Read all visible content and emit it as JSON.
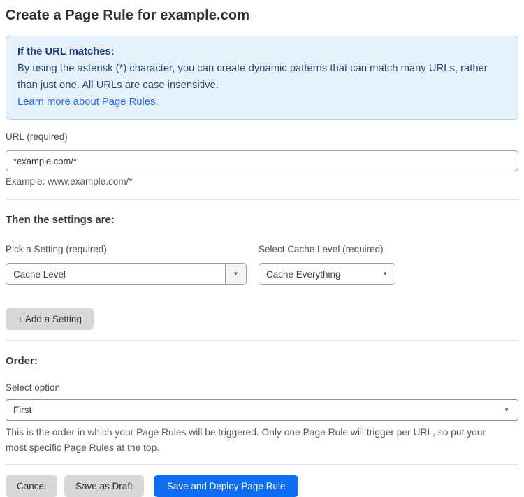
{
  "page": {
    "title": "Create a Page Rule for example.com"
  },
  "info_box": {
    "heading": "If the URL matches:",
    "body": "By using the asterisk (*) character, you can create dynamic patterns that can match many URLs, rather than just one. All URLs are case insensitive.",
    "link_label": "Learn more about Page Rules",
    "link_suffix": "."
  },
  "url_field": {
    "label": "URL (required)",
    "value": "*example.com/*",
    "helper": "Example: www.example.com/*"
  },
  "settings_section": {
    "heading": "Then the settings are:",
    "pick_setting": {
      "label": "Pick a Setting (required)",
      "value": "Cache Level"
    },
    "cache_level": {
      "label": "Select Cache Level (required)",
      "value": "Cache Everything"
    },
    "add_setting_label": "+ Add a Setting"
  },
  "order_section": {
    "heading": "Order:",
    "select_label": "Select option",
    "selected_value": "First",
    "helper": "This is the order in which your Page Rules will be triggered. Only one Page Rule will trigger per URL, so put your most specific Page Rules at the top."
  },
  "footer": {
    "cancel_label": "Cancel",
    "save_draft_label": "Save as Draft",
    "save_deploy_label": "Save and Deploy Page Rule"
  },
  "icons": {
    "dropdown_arrow": "▼"
  },
  "colors": {
    "accent_blue": "#0d6ef2",
    "info_bg": "#e7f1fb",
    "info_border": "#b3d4f0",
    "info_text": "#27477e",
    "link_blue": "#2c6cd6"
  }
}
